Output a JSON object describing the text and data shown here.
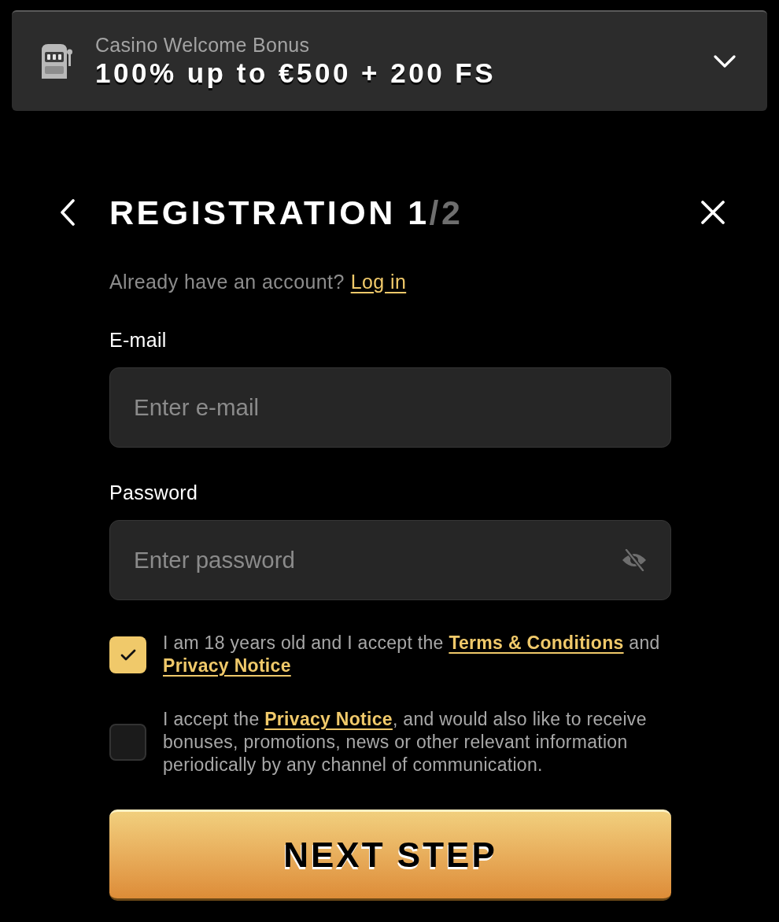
{
  "bonus_banner": {
    "category": "Casino Welcome Bonus",
    "offer": "100% up to €500 + 200 FS",
    "expanded": false
  },
  "registration": {
    "title": "REGISTRATION 1",
    "step_total": "/2"
  },
  "login_prompt": {
    "text": "Already have an account?",
    "link": "Log in"
  },
  "fields": [
    {
      "kind": "email",
      "label": "E-mail",
      "placeholder": "Enter e-mail"
    },
    {
      "kind": "password",
      "label": "Password",
      "placeholder": "Enter password",
      "password_visible": false
    }
  ],
  "consents": [
    {
      "checked": true,
      "parts": [
        {
          "kind": "text",
          "text": "I am 18 years old and I accept the "
        },
        {
          "kind": "link",
          "text": "Terms & Conditions"
        },
        {
          "kind": "text",
          "text": " and "
        },
        {
          "kind": "link",
          "text": "Privacy Notice"
        }
      ]
    },
    {
      "checked": false,
      "parts": [
        {
          "kind": "text",
          "text": "I accept the "
        },
        {
          "kind": "link",
          "text": "Privacy Notice"
        },
        {
          "kind": "text",
          "text": ", and would also like to receive bonuses, promotions, news or other relevant information periodically by any channel of communication."
        }
      ]
    }
  ],
  "submit_button": "NEXT STEP"
}
